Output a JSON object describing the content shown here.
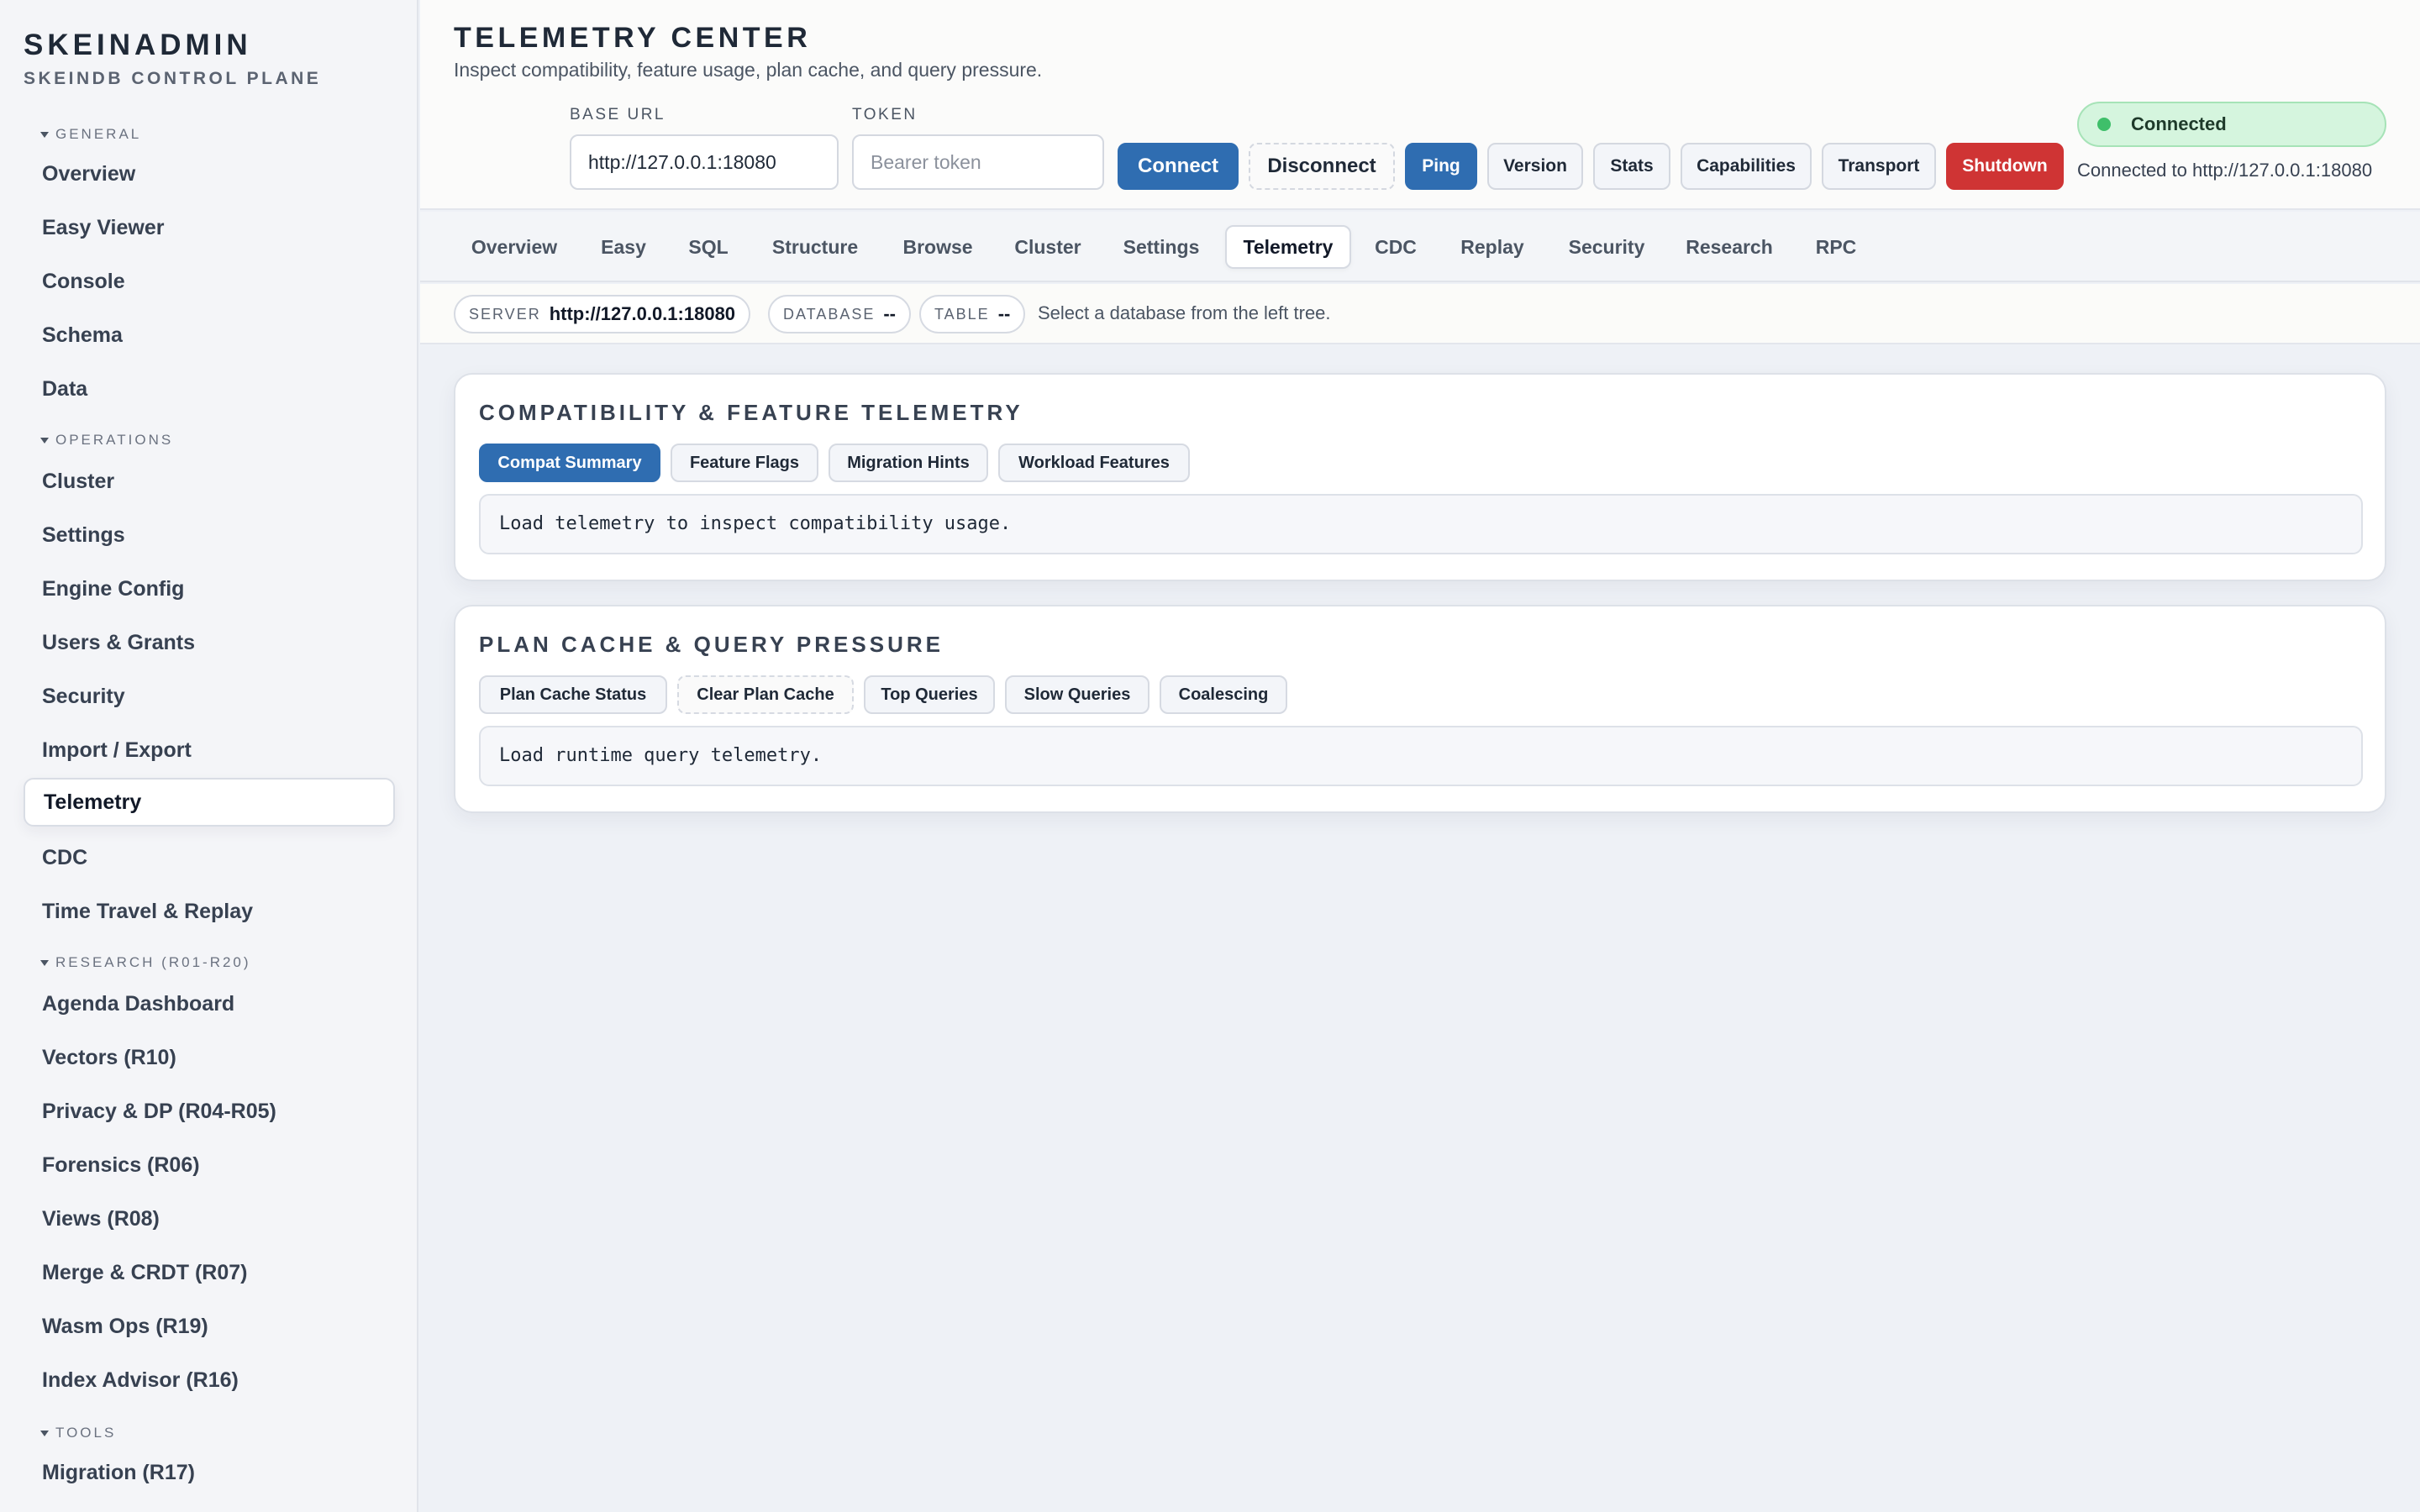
{
  "brand": {
    "title": "SKEINADMIN",
    "subtitle": "SKEINDB CONTROL PLANE"
  },
  "sidebar": {
    "sections": [
      {
        "label": "GENERAL",
        "items": [
          "Overview",
          "Easy Viewer",
          "Console",
          "Schema",
          "Data"
        ]
      },
      {
        "label": "OPERATIONS",
        "items": [
          "Cluster",
          "Settings",
          "Engine Config",
          "Users & Grants",
          "Security",
          "Import / Export",
          "Telemetry",
          "CDC",
          "Time Travel & Replay"
        ]
      },
      {
        "label": "RESEARCH (R01-R20)",
        "items": [
          "Agenda Dashboard",
          "Vectors (R10)",
          "Privacy & DP (R04-R05)",
          "Forensics (R06)",
          "Views (R08)",
          "Merge & CRDT (R07)",
          "Wasm Ops (R19)",
          "Index Advisor (R16)"
        ]
      },
      {
        "label": "TOOLS",
        "items": [
          "Migration (R17)"
        ]
      }
    ],
    "active": "Telemetry"
  },
  "header": {
    "title": "TELEMETRY CENTER",
    "subtitle": "Inspect compatibility, feature usage, plan cache, and query pressure.",
    "base_url_label": "BASE URL",
    "base_url_value": "http://127.0.0.1:18080",
    "token_label": "TOKEN",
    "token_placeholder": "Bearer token",
    "buttons": {
      "connect": "Connect",
      "disconnect": "Disconnect",
      "ping": "Ping",
      "version": "Version",
      "stats": "Stats",
      "capabilities": "Capabilities",
      "transport": "Transport",
      "shutdown": "Shutdown"
    },
    "status": {
      "label": "Connected",
      "detail": "Connected to http://127.0.0.1:18080",
      "color": "#3fbf6a"
    }
  },
  "tabs": [
    "Overview",
    "Easy",
    "SQL",
    "Structure",
    "Browse",
    "Cluster",
    "Settings",
    "Telemetry",
    "CDC",
    "Replay",
    "Security",
    "Research",
    "RPC"
  ],
  "active_tab": "Telemetry",
  "context": {
    "server_key": "SERVER",
    "server_val": "http://127.0.0.1:18080",
    "database_key": "DATABASE",
    "database_val": "--",
    "table_key": "TABLE",
    "table_val": "--",
    "message": "Select a database from the left tree."
  },
  "panels": {
    "compat": {
      "title": "COMPATIBILITY & FEATURE TELEMETRY",
      "buttons": [
        "Compat Summary",
        "Feature Flags",
        "Migration Hints",
        "Workload Features"
      ],
      "output": "Load telemetry to inspect compatibility usage."
    },
    "plan": {
      "title": "PLAN CACHE & QUERY PRESSURE",
      "buttons": [
        "Plan Cache Status",
        "Clear Plan Cache",
        "Top Queries",
        "Slow Queries",
        "Coalescing"
      ],
      "output": "Load runtime query telemetry."
    }
  },
  "colors": {
    "accent": "#2f6db1",
    "danger": "#cf3434",
    "success_bg": "#d5f5de"
  }
}
